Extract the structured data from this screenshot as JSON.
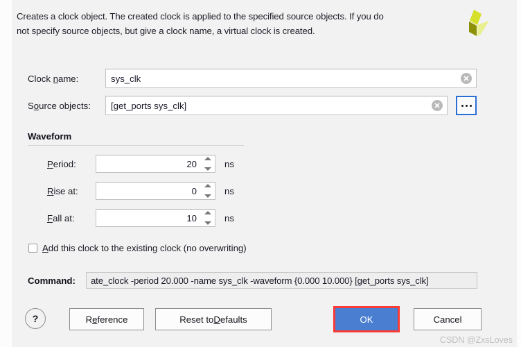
{
  "dialog": {
    "description_line1": "Creates a clock object. The created clock is applied to the specified source objects. If you do",
    "description_line2": "not specify source objects, but give a clock name, a virtual clock is created.",
    "logo_name": "xilinx-logo"
  },
  "fields": {
    "clock_name": {
      "label_pre": "Clock ",
      "label_accel": "n",
      "label_post": "ame:",
      "value": "sys_clk",
      "placeholder": "",
      "clear_icon": "clear-circle-icon"
    },
    "source_objects": {
      "label_pre": "S",
      "label_accel": "o",
      "label_post": "urce objects:",
      "value": "[get_ports sys_clk]",
      "placeholder": "",
      "clear_icon": "clear-circle-icon",
      "browse_label": "..."
    }
  },
  "waveform": {
    "title": "Waveform",
    "rows": [
      {
        "label_pre": "",
        "label_accel": "P",
        "label_post": "eriod:",
        "value": "20",
        "unit": "ns"
      },
      {
        "label_pre": "",
        "label_accel": "R",
        "label_post": "ise at:",
        "value": "0",
        "unit": "ns"
      },
      {
        "label_pre": "",
        "label_accel": "F",
        "label_post": "all at:",
        "value": "10",
        "unit": "ns"
      }
    ]
  },
  "checkbox": {
    "checked": false,
    "label_pre": "",
    "label_accel": "A",
    "label_post": "dd this clock to the existing clock (no overwriting)"
  },
  "command": {
    "label": "Command:",
    "value": "ate_clock -period 20.000 -name sys_clk -waveform {0.000 10.000} [get_ports sys_clk]"
  },
  "buttons": {
    "help": "?",
    "reference_pre": "R",
    "reference_accel": "e",
    "reference_post": "ference",
    "reset_pre": "Reset to ",
    "reset_accel": "D",
    "reset_post": "efaults",
    "ok": "OK",
    "cancel": "Cancel"
  },
  "annotation": {
    "ok_highlight_color": "#fb3b35",
    "ok_button_color": "#4a7ed0"
  },
  "watermark": "CSDN @ZxsLoves"
}
